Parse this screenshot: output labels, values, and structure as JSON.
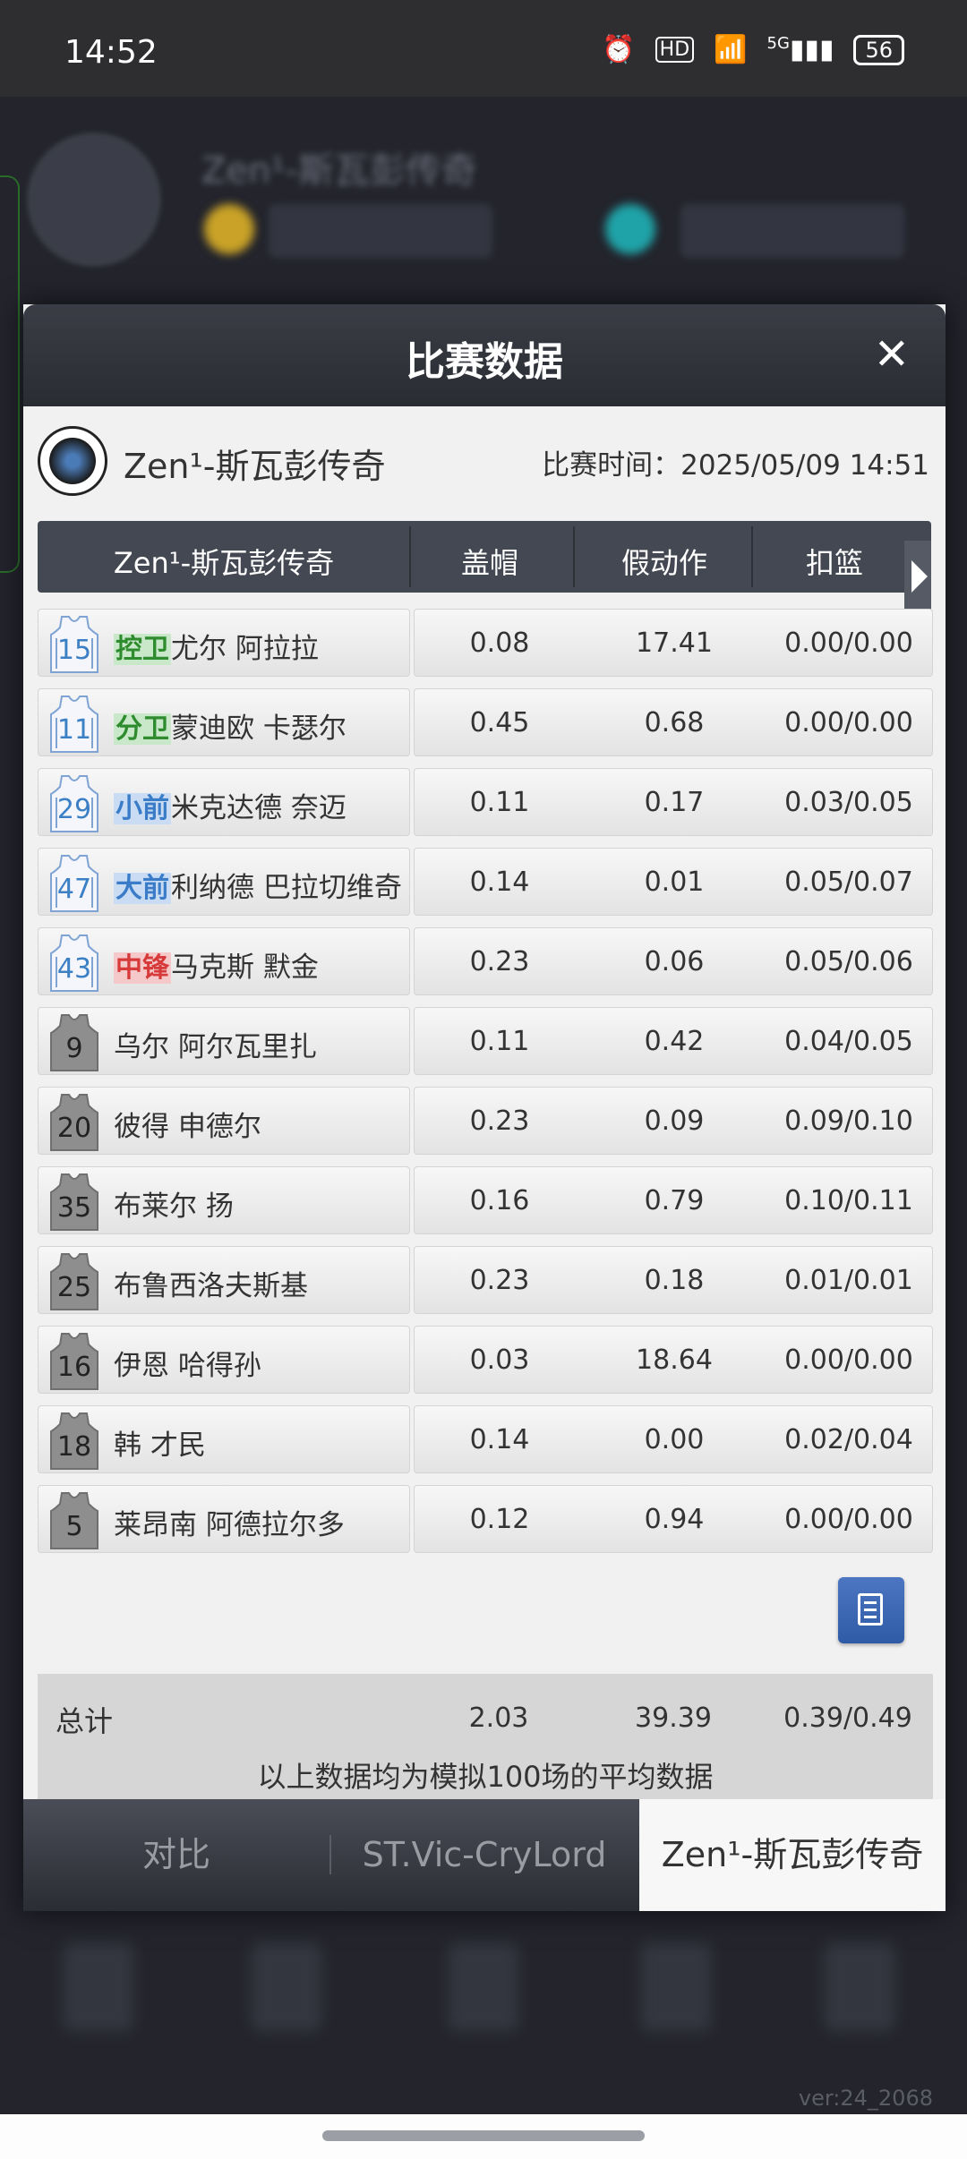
{
  "status_bar": {
    "time": "14:52",
    "battery": "56",
    "hd": "HD",
    "network": "5G"
  },
  "dialog": {
    "title": "比赛数据",
    "close": "✕",
    "team_name": "Zen¹-斯瓦彭传奇",
    "match_time": "比赛时间：2025/05/09 14:51",
    "columns": [
      "Zen¹-斯瓦彭传奇",
      "盖帽",
      "假动作",
      "扣篮"
    ],
    "players": [
      {
        "number": "15",
        "position": "控卫",
        "name": "尤尔 阿拉拉",
        "block": "0.08",
        "fake": "17.41",
        "dunk": "0.00/0.00"
      },
      {
        "number": "11",
        "position": "分卫",
        "name": "蒙迪欧 卡瑟尔",
        "block": "0.45",
        "fake": "0.68",
        "dunk": "0.00/0.00"
      },
      {
        "number": "29",
        "position": "小前",
        "name": "米克达德 奈迈",
        "block": "0.11",
        "fake": "0.17",
        "dunk": "0.03/0.05"
      },
      {
        "number": "47",
        "position": "大前",
        "name": "利纳德 巴拉切维奇",
        "block": "0.14",
        "fake": "0.01",
        "dunk": "0.05/0.07"
      },
      {
        "number": "43",
        "position": "中锋",
        "name": "马克斯 默金",
        "block": "0.23",
        "fake": "0.06",
        "dunk": "0.05/0.06"
      },
      {
        "number": "9",
        "position": "",
        "name": "乌尔 阿尔瓦里扎",
        "block": "0.11",
        "fake": "0.42",
        "dunk": "0.04/0.05"
      },
      {
        "number": "20",
        "position": "",
        "name": "彼得 申德尔",
        "block": "0.23",
        "fake": "0.09",
        "dunk": "0.09/0.10"
      },
      {
        "number": "35",
        "position": "",
        "name": "布莱尔 扬",
        "block": "0.16",
        "fake": "0.79",
        "dunk": "0.10/0.11"
      },
      {
        "number": "25",
        "position": "",
        "name": "布鲁西洛夫斯基",
        "block": "0.23",
        "fake": "0.18",
        "dunk": "0.01/0.01"
      },
      {
        "number": "16",
        "position": "",
        "name": "伊恩 哈得孙",
        "block": "0.03",
        "fake": "18.64",
        "dunk": "0.00/0.00"
      },
      {
        "number": "18",
        "position": "",
        "name": "韩 才民",
        "block": "0.14",
        "fake": "0.00",
        "dunk": "0.02/0.04"
      },
      {
        "number": "5",
        "position": "",
        "name": "莱昂南 阿德拉尔多",
        "block": "0.12",
        "fake": "0.94",
        "dunk": "0.00/0.00"
      }
    ],
    "total": {
      "label": "总计",
      "block": "2.03",
      "fake": "39.39",
      "dunk": "0.39/0.49"
    },
    "note": "以上数据均为模拟100场的平均数据",
    "tabs": [
      "对比",
      "ST.Vic-CryLord",
      "Zen¹-斯瓦彭传奇"
    ],
    "active_tab": 2
  },
  "position_colors": {
    "控卫": "#2e8b2e",
    "分卫": "#2e8b2e",
    "小前": "#3a7cc8",
    "大前": "#3a7cc8",
    "中锋": "#d63a3a"
  },
  "background": {
    "blurred_name": "Zen¹-斯瓦彭传奇",
    "version": "ver:24_2068"
  }
}
